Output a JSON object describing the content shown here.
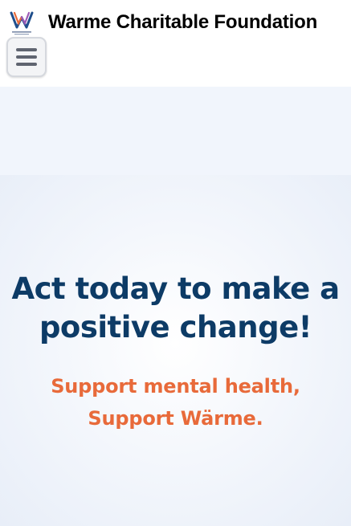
{
  "header": {
    "site_title": "Warme Charitable Foundation",
    "logo_icon": "warme-w-logo",
    "menu_icon": "hamburger-menu-icon"
  },
  "hero": {
    "heading": "Act today to make a positive change!",
    "subheading_line1": "Support mental health,",
    "subheading_line2": "Support Wärme."
  },
  "colors": {
    "heading": "#0d3b66",
    "subheading": "#e86a3a",
    "band": "#f1f5fc"
  }
}
